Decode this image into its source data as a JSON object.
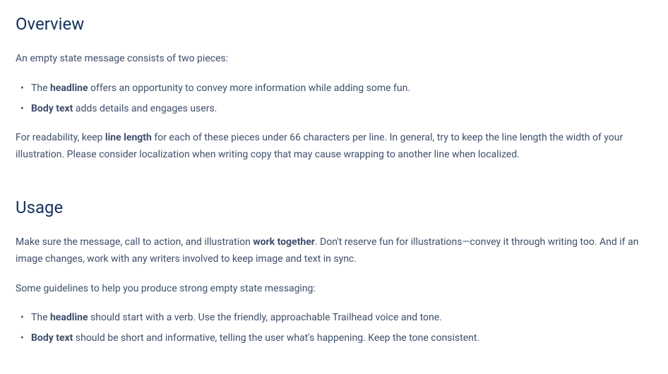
{
  "overview": {
    "heading": "Overview",
    "intro": "An empty state message consists of two pieces:",
    "bullets": [
      {
        "pre": "The ",
        "bold": "headline",
        "post": " offers an opportunity to convey more information while adding some fun."
      },
      {
        "pre": "",
        "bold": "Body text",
        "post": " adds details and engages users."
      }
    ],
    "readability_pre": "For readability, keep ",
    "readability_bold": "line length",
    "readability_post": " for each of these pieces under 66 characters per line. In general, try to keep the line length the width of your illustration. Please consider localization when writing copy that may cause wrapping to another line when localized."
  },
  "usage": {
    "heading": "Usage",
    "intro_pre": "Make sure the message, call to action, and illustration ",
    "intro_bold": "work together",
    "intro_post": ". Don't reserve fun for illustrations—convey it through writing too. And if an image changes, work with any writers involved to keep image and text in sync.",
    "guidelines_intro": "Some guidelines to help you produce strong empty state messaging:",
    "bullets": [
      {
        "pre": "The ",
        "bold": "headline",
        "post": " should start with a verb. Use the friendly, approachable Trailhead voice and tone."
      },
      {
        "pre": "",
        "bold": "Body text",
        "post": " should be short and informative, telling the user what's happening. Keep the tone consistent."
      }
    ]
  }
}
